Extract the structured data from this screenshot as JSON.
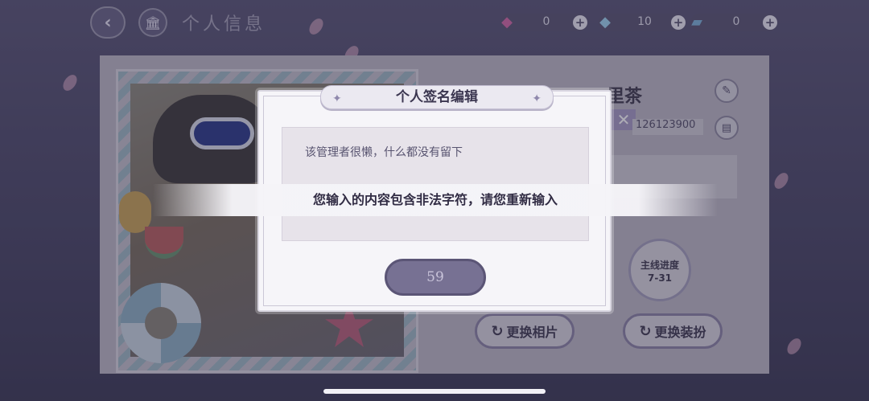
{
  "header": {
    "title": "个人信息",
    "back_icon": "back-arrow-icon",
    "home_icon": "museum-icon"
  },
  "currencies": [
    {
      "icon": "pink-gem-icon",
      "color": "#d46aa6",
      "value": "0"
    },
    {
      "icon": "blue-gem-icon",
      "color": "#9fd3ef",
      "value": "10"
    },
    {
      "icon": "ticket-icon",
      "color": "#7cb2d8",
      "value": "0"
    }
  ],
  "profile": {
    "name": "里茶",
    "uid": "126123900",
    "main_progress_label": "主线进度",
    "main_progress_value": "7-31",
    "change_photo_label": "更换相片",
    "change_outfit_label": "更换装扮"
  },
  "modal": {
    "title": "个人签名编辑",
    "signature_text": "该管理者很懒，什么都没有留下",
    "char_count": "59"
  },
  "toast": {
    "message": "您输入的内容包含非法字符，请您重新输入"
  }
}
